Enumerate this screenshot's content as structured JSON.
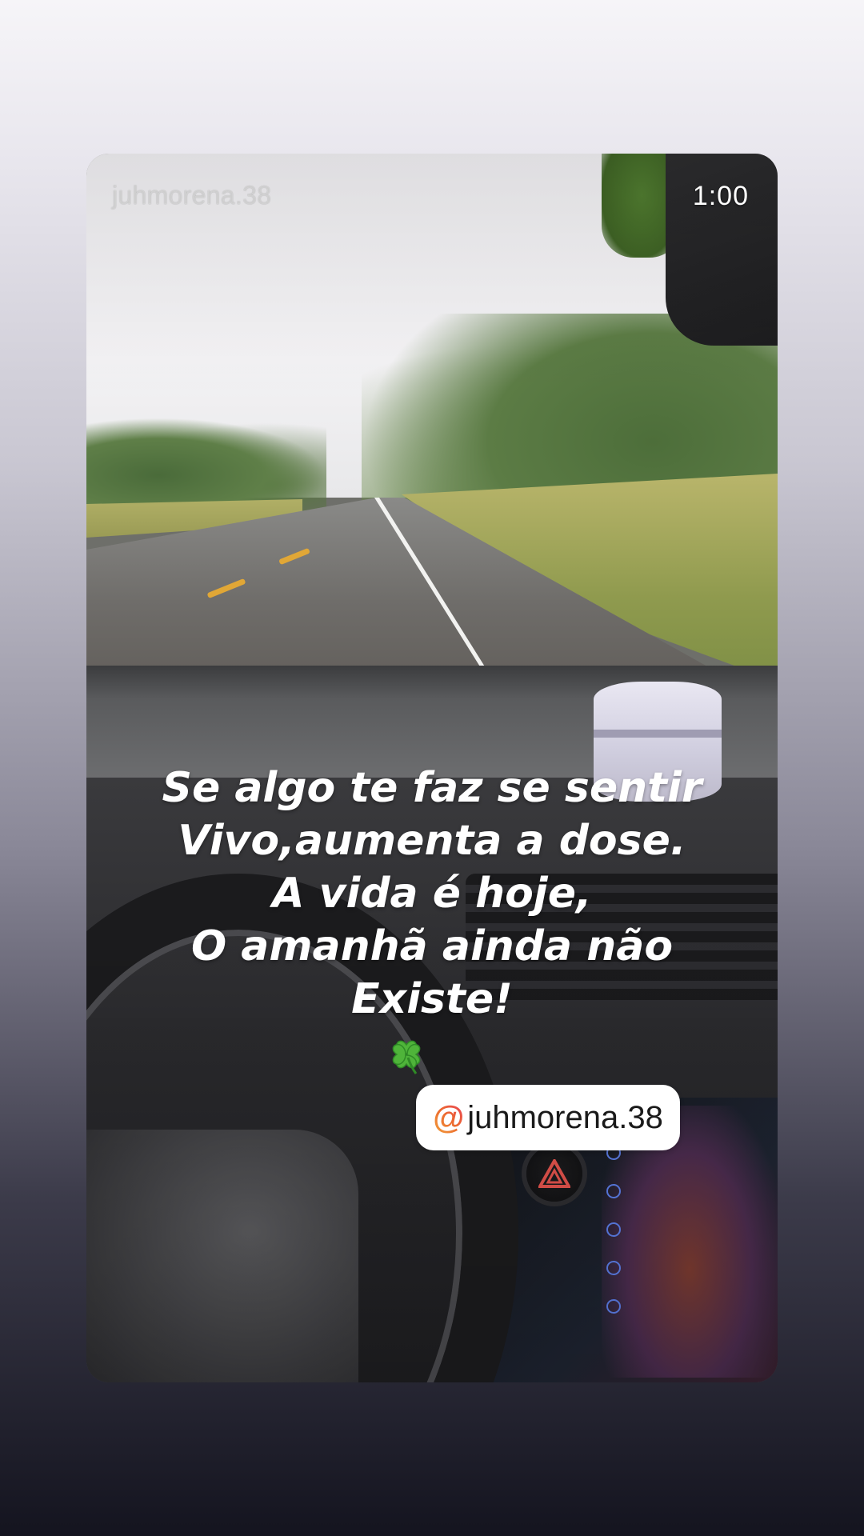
{
  "story": {
    "username": "juhmorena.38",
    "timer": "1:00"
  },
  "caption": {
    "lines": [
      "Se algo te faz se sentir",
      "Vivo,aumenta a dose.",
      "A vida é hoje,",
      "O amanhã ainda não",
      "Existe!"
    ],
    "emoji": "four-leaf-clover"
  },
  "mention_sticker": {
    "at_symbol": "@",
    "handle": "juhmorena.38",
    "accent_colors": [
      "#f2a03a",
      "#ec6a2f",
      "#e83c5a"
    ]
  },
  "icons": {
    "hazard": "hazard-triangle-icon",
    "clover": "four-leaf-clover-icon"
  }
}
